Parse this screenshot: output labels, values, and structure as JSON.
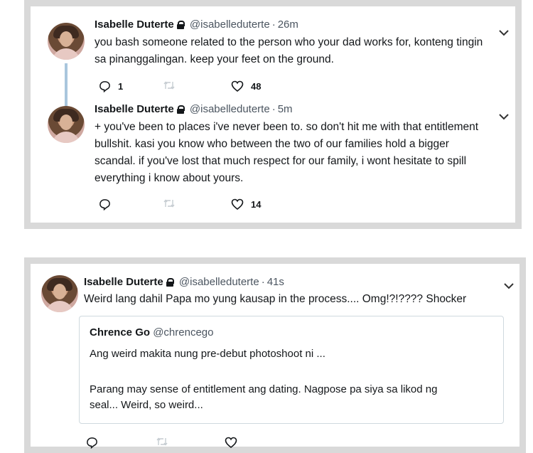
{
  "tweets": [
    {
      "name": "Isabelle Duterte",
      "handle": "@isabelleduterte",
      "time": "26m",
      "text_lines": [
        "you bash someone related to the person who your dad works for, konteng tingin",
        "sa pinanggalingan. keep your feet on the ground."
      ],
      "reply_count": "1",
      "like_count": "48"
    },
    {
      "name": "Isabelle Duterte",
      "handle": "@isabelleduterte",
      "time": "5m",
      "text_lines": [
        "+ you've been to places i've never been to. so don't hit me with that entitlement",
        "bullshit. kasi you know who between the two of our families hold a bigger",
        "scandal. if you've lost that much respect for our family, i wont hesitate to spill",
        "everything i know about yours."
      ],
      "like_count": "14"
    },
    {
      "name": "Isabelle Duterte",
      "handle": "@isabelleduterte",
      "time": "41s",
      "text_lines": [
        "Weird lang dahil Papa mo yung kausap in the process.... Omg!?!???? Shocker"
      ],
      "quote": {
        "name": "Chrence Go",
        "handle": "@chrencego",
        "line1": "Ang weird makita nung pre-debut photoshoot ni ...",
        "line2": "Parang may sense of entitlement ang dating.  Nagpose pa siya sa likod ng",
        "line3": "seal... Weird, so weird..."
      }
    }
  ],
  "separator": "·",
  "icons": {
    "reply": "reply-icon",
    "retweet": "retweet-icon",
    "like": "heart-icon",
    "menu": "chevron-down-icon",
    "lock": "lock-icon"
  },
  "colors": {
    "frame": "#d9d9d9",
    "thread_line": "#a9c6dd",
    "text": "#14171a",
    "muted": "#4b5560"
  }
}
